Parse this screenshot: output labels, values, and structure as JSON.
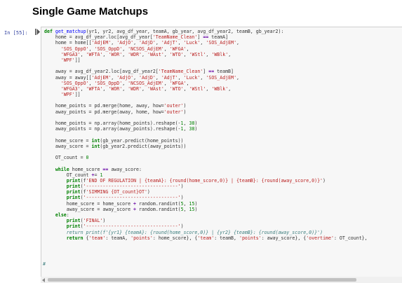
{
  "heading": "Single Game Matchups",
  "prompt": "In [55]:",
  "icons": {
    "run_marker": "run-cell-icon",
    "scroll_left": "chevron-left-icon"
  },
  "code_lines": [
    "def get_matchup(yr1, yr2, avg_df_year, teamA, gb_year, avg_df_year2, teamB, gb_year2):",
    "    home = avg_df_year.loc[avg_df_year['TeamName_Clean'] == teamA]",
    "    home = home[['AdjEM', 'AdjO', 'AdjD', 'AdjT', 'Luck', 'SOS_AdjEM',",
    "      'SOS_OppO', 'SOS_OppD', 'NCSOS_AdjEM', 'WFGA',",
    "      'WFGA3', 'WFTA', 'WOR', 'WDR', 'WAst', 'WTO', 'WStl', 'WBlk',",
    "      'WPF']]",
    "",
    "    away = avg_df_year2.loc[avg_df_year2['TeamName_Clean'] == teamB]",
    "    away = away[['AdjEM', 'AdjO', 'AdjD', 'AdjT', 'Luck', 'SOS_AdjEM',",
    "      'SOS_OppO', 'SOS_OppD', 'NCSOS_AdjEM', 'WFGA',",
    "      'WFGA3', 'WFTA', 'WOR', 'WDR', 'WAst', 'WTO', 'WStl', 'WBlk',",
    "      'WPF']]",
    "",
    "    home_points = pd.merge(home, away, how='outer')",
    "    away_points = pd.merge(away, home, how='outer')",
    "",
    "    home_points = np.array(home_points).reshape(-1, 38)",
    "    away_points = np.array(away_points).reshape(-1, 38)",
    "",
    "    home_score = int(gb_year.predict(home_points))",
    "    away_score = int(gb_year2.predict(away_points))",
    "",
    "    OT_count = 0",
    "",
    "    while home_score == away_score:",
    "        OT_count += 1",
    "        print(f'END OF REGULATION | {teamA}: {round(home_score,0)} | {teamB}: {round(away_score,0)}')",
    "        print('---------------------------------')",
    "        print(f'SIMMING {OT_count}OT')",
    "        print('---------------------------------')",
    "        home_score = home_score + random.randint(5, 15)",
    "        away_score = away_score + random.randint(5, 15)",
    "    else:",
    "        print('FINAL')",
    "        print('---------------------------------')",
    "        return print(f'{yr1} {teamA}: {round(home_score,0)} | {yr2} {teamB}: {round(away_score,0)}')",
    "        return {'team': teamA, 'points': home_score}, {'team': teamB, 'points': away_score}, {'overtime': OT_count},"
  ],
  "comment_marker": "#"
}
